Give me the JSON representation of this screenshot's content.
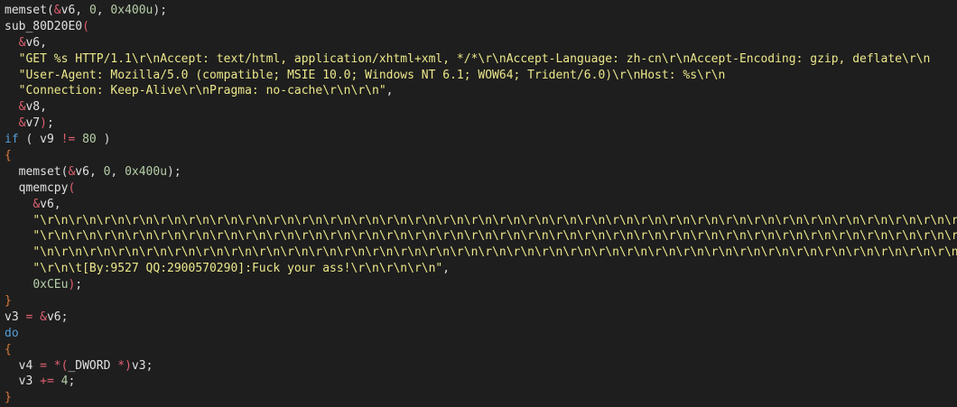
{
  "colors": {
    "background": "#1e1e1e",
    "plain": "#e1e1e1",
    "punct": "#dcdcdc",
    "operator": "#e06070",
    "number": "#b5cea8",
    "string": "#ece78a",
    "keyword": "#569cd6",
    "brace": "#d97b3a"
  },
  "code_lines": [
    [
      [
        "memset",
        "plain"
      ],
      [
        "(",
        "punct"
      ],
      [
        "&",
        "operator"
      ],
      [
        "v6",
        "plain"
      ],
      [
        ", ",
        "punct"
      ],
      [
        "0",
        "number"
      ],
      [
        ", ",
        "punct"
      ],
      [
        "0x400u",
        "number"
      ],
      [
        ");",
        "punct"
      ]
    ],
    [
      [
        "sub_80D20E0",
        "plain"
      ],
      [
        "(",
        "operator"
      ]
    ],
    [
      [
        "  ",
        "plain"
      ],
      [
        "&",
        "operator"
      ],
      [
        "v6",
        "plain"
      ],
      [
        ",",
        "punct"
      ]
    ],
    [
      [
        "  ",
        "plain"
      ],
      [
        "\"GET %s HTTP/1.1\\r\\nAccept: text/html, application/xhtml+xml, */*\\r\\nAccept-Language: zh-cn\\r\\nAccept-Encoding: gzip, deflate\\r\\n",
        "string"
      ]
    ],
    [
      [
        "  ",
        "plain"
      ],
      [
        "\"User-Agent: Mozilla/5.0 (compatible; MSIE 10.0; Windows NT 6.1; WOW64; Trident/6.0)\\r\\nHost: %s\\r\\n",
        "string"
      ]
    ],
    [
      [
        "  ",
        "plain"
      ],
      [
        "\"Connection: Keep-Alive\\r\\nPragma: no-cache\\r\\n\\r\\n\"",
        "string"
      ],
      [
        ",",
        "punct"
      ]
    ],
    [
      [
        "  ",
        "plain"
      ],
      [
        "&",
        "operator"
      ],
      [
        "v8",
        "plain"
      ],
      [
        ",",
        "punct"
      ]
    ],
    [
      [
        "  ",
        "plain"
      ],
      [
        "&",
        "operator"
      ],
      [
        "v7",
        "plain"
      ],
      [
        ")",
        "operator"
      ],
      [
        ";",
        "punct"
      ]
    ],
    [
      [
        "if",
        "keyword"
      ],
      [
        " ( ",
        "punct"
      ],
      [
        "v9",
        "plain"
      ],
      [
        " != ",
        "operator"
      ],
      [
        "80",
        "number"
      ],
      [
        " )",
        "punct"
      ]
    ],
    [
      [
        "{",
        "brace"
      ]
    ],
    [
      [
        "  ",
        "plain"
      ],
      [
        "memset",
        "plain"
      ],
      [
        "(",
        "punct"
      ],
      [
        "&",
        "operator"
      ],
      [
        "v6",
        "plain"
      ],
      [
        ", ",
        "punct"
      ],
      [
        "0",
        "number"
      ],
      [
        ", ",
        "punct"
      ],
      [
        "0x400u",
        "number"
      ],
      [
        ");",
        "punct"
      ]
    ],
    [
      [
        "  ",
        "plain"
      ],
      [
        "qmemcpy",
        "plain"
      ],
      [
        "(",
        "operator"
      ]
    ],
    [
      [
        "    ",
        "plain"
      ],
      [
        "&",
        "operator"
      ],
      [
        "v6",
        "plain"
      ],
      [
        ",",
        "punct"
      ]
    ],
    [
      [
        "    ",
        "plain"
      ],
      [
        "\"\\r\\n\\r\\n\\r\\n\\r\\n\\r\\n\\r\\n\\r\\n\\r\\n\\r\\n\\r\\n\\r\\n\\r\\n\\r\\n\\r\\n\\r\\n\\r\\n\\r\\n\\r\\n\\r\\n\\r\\n\\r\\n\\r\\n\\r\\n\\r\\n\\r\\n\\r\\n\\r\\n\\r\\n\\r\\n\\r\\n\\r\\n\\r\\n\\r\\n\\r\\n\\r\\n\\r\\n\\r\\n\\r\\n\\r\\n\\r\\n\\r\\n\\r\\n\\r\\n\\r\\n\\r\\n\\r\\n\\r\\n\\r\\n\\r\\n\\r\\n\\r\\n\\r\\n\\r\\n\\r\\n\\r\\n\\r\\n\\r\\n\\r\\n\\r\\n\\r\\n",
        "string"
      ]
    ],
    [
      [
        "    ",
        "plain"
      ],
      [
        "\"\\r\\n\\r\\n\\r\\n\\r\\n\\r\\n\\r\\n\\r\\n\\r\\n\\r\\n\\r\\n\\r\\n\\r\\n\\r\\n\\r\\n\\r\\n\\r\\n\\r\\n\\r\\n\\r\\n\\r\\n\\r\\n\\r\\n\\r\\n\\r\\n\\r\\n\\r\\n\\r\\n\\r\\n\\r\\n\\r\\n\\r\\n\\r\\n\\r\\n\\r\\n\\r\\n\\r\\n\\r\\n\\r\\n\\r\\n\\r\\n\\r\\n\\r\\n\\r\\n\\r\\n\\r\\n\\r\\n\\r\\n\\r\\n\\r\\n\\r\\n\\r\\n\\r\\n\\r\\n\\r\\n\\r\\n\\r\\n\\r\\n\\r\\n\\r",
        "string"
      ]
    ],
    [
      [
        "    ",
        "plain"
      ],
      [
        "\"\\n\\r\\n\\r\\n\\r\\n\\r\\n\\r\\n\\r\\n\\r\\n\\r\\n\\r\\n\\r\\n\\r\\n\\r\\n\\r\\n\\r\\n\\r\\n\\r\\n\\r\\n\\r\\n\\r\\n\\r\\n\\r\\n\\r\\n\\r\\n\\r\\n\\r\\n\\r\\n\\r\\n\\r\\n\\r\\n\\r\\n\\r\\n\\r\\n\\r\\n\\r\\n\\r\\n\\r\\n\\r\\n\\r\\n\\r\\n\\r\\n\\r\\n\\r\\n\\r\\n\\r\\n\\r\\n\\r\\n\\r\\n\\r\\n\\r\\n\\r\\n\\r\\n\\r\\n\\r\\n\\r\\n\\r\\n\\r\\n\\r\\n\\r\\n",
        "string"
      ]
    ],
    [
      [
        "    ",
        "plain"
      ],
      [
        "\"\\r\\n\\t[By:9527 QQ:2900570290]:Fuck your ass!\\r\\n\\r\\n\\r\\n\"",
        "string"
      ],
      [
        ",",
        "punct"
      ]
    ],
    [
      [
        "    ",
        "plain"
      ],
      [
        "0xCEu",
        "number"
      ],
      [
        ")",
        "operator"
      ],
      [
        ";",
        "punct"
      ]
    ],
    [
      [
        "}",
        "brace"
      ]
    ],
    [
      [
        "v3",
        "plain"
      ],
      [
        " = ",
        "operator"
      ],
      [
        "&",
        "operator"
      ],
      [
        "v6",
        "plain"
      ],
      [
        ";",
        "punct"
      ]
    ],
    [
      [
        "do",
        "keyword"
      ]
    ],
    [
      [
        "{",
        "brace"
      ]
    ],
    [
      [
        "  ",
        "plain"
      ],
      [
        "v4",
        "plain"
      ],
      [
        " = ",
        "operator"
      ],
      [
        "*(",
        "operator"
      ],
      [
        "_DWORD",
        "plain"
      ],
      [
        " *)",
        "operator"
      ],
      [
        "v3",
        "plain"
      ],
      [
        ";",
        "punct"
      ]
    ],
    [
      [
        "  ",
        "plain"
      ],
      [
        "v3",
        "plain"
      ],
      [
        " += ",
        "operator"
      ],
      [
        "4",
        "number"
      ],
      [
        ";",
        "punct"
      ]
    ],
    [
      [
        "}",
        "brace"
      ]
    ]
  ]
}
